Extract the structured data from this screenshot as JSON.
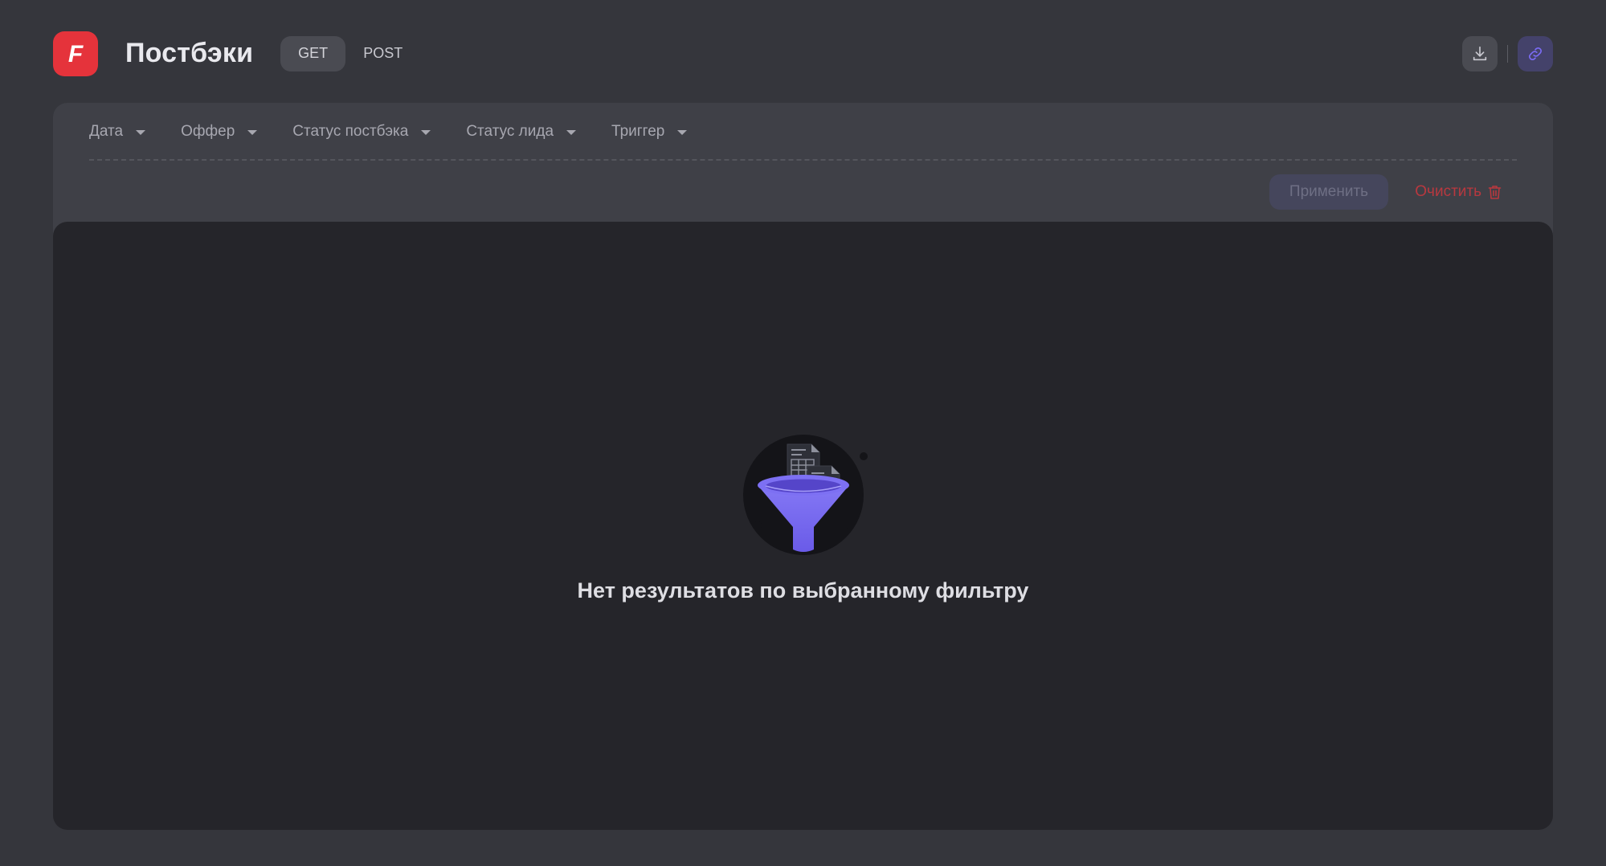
{
  "header": {
    "logo_letter": "F",
    "title": "Постбэки",
    "method_tabs": [
      {
        "label": "GET",
        "active": true
      },
      {
        "label": "POST",
        "active": false
      }
    ]
  },
  "filters": {
    "items": [
      {
        "label": "Дата"
      },
      {
        "label": "Оффер"
      },
      {
        "label": "Статус постбэка"
      },
      {
        "label": "Статус лида"
      },
      {
        "label": "Триггер"
      }
    ],
    "apply_label": "Применить",
    "clear_label": "Очистить"
  },
  "results": {
    "empty_message": "Нет результатов по выбранному фильтру"
  },
  "colors": {
    "brand": "#e5333b",
    "accent": "#7b6cf6",
    "danger": "#b8383f",
    "background": "#35363c",
    "panel": "#3f4047",
    "content": "#25252a"
  },
  "icons": {
    "logo": "brand-f-logo",
    "download": "download-icon",
    "link": "link-icon",
    "clear": "trash-icon",
    "filter_caret": "caret-down-icon",
    "empty_state": "funnel-illustration"
  }
}
